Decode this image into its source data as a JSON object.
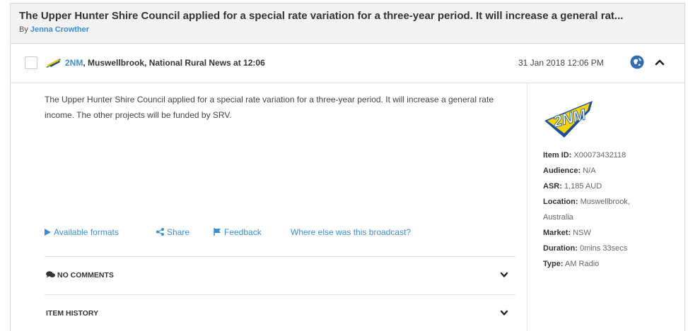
{
  "header": {
    "title": "The Upper Hunter Shire Council applied for a special rate variation for a three-year period. It will increase a general rat...",
    "byline_prefix": "By",
    "author": "Jenna Crowther"
  },
  "item": {
    "station": "2NM",
    "source_rest": ", Muswellbrook, National Rural News at 12:06",
    "timestamp": "31 Jan 2018 12:06 PM",
    "summary": "The Upper Hunter Shire Council applied for a special rate variation for a three-year period. It will increase a general rate income. The other projects will be funded by SRV."
  },
  "actions": {
    "available_formats": "Available formats",
    "share": "Share",
    "feedback": "Feedback",
    "where_else": "Where else was this broadcast?"
  },
  "sections": {
    "comments": "NO COMMENTS",
    "history": "ITEM HISTORY"
  },
  "meta": {
    "logo_text": "2NM",
    "item_id_label": "Item ID:",
    "item_id": "X00073432118",
    "audience_label": "Audience:",
    "audience": "N/A",
    "asr_label": "ASR:",
    "asr": "1,185 AUD",
    "location_label": "Location:",
    "location_line1": "Muswellbrook,",
    "location_line2": "Australia",
    "market_label": "Market:",
    "market": "NSW",
    "duration_label": "Duration:",
    "duration": "0mins 33secs",
    "type_label": "Type:",
    "type": "AM Radio"
  },
  "colors": {
    "accent": "#3a8dd6",
    "header_bg": "#f2f2f2",
    "logo_yellow": "#f5d400",
    "logo_blue": "#1a4fa0"
  }
}
